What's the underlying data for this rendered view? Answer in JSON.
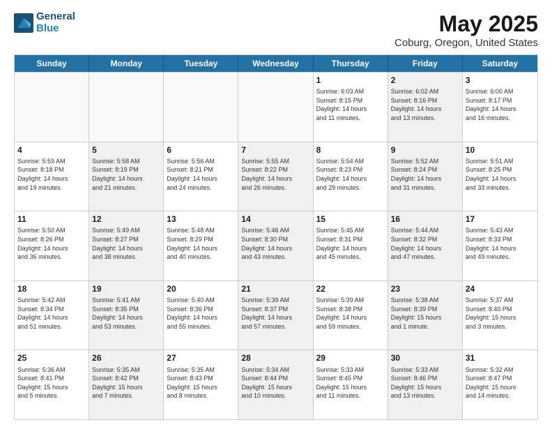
{
  "header": {
    "logo_line1": "General",
    "logo_line2": "Blue",
    "title": "May 2025",
    "subtitle": "Coburg, Oregon, United States"
  },
  "weekdays": [
    "Sunday",
    "Monday",
    "Tuesday",
    "Wednesday",
    "Thursday",
    "Friday",
    "Saturday"
  ],
  "weeks": [
    [
      {
        "day": "",
        "info": "",
        "empty": true
      },
      {
        "day": "",
        "info": "",
        "empty": true
      },
      {
        "day": "",
        "info": "",
        "empty": true
      },
      {
        "day": "",
        "info": "",
        "empty": true
      },
      {
        "day": "1",
        "info": "Sunrise: 6:03 AM\nSunset: 8:15 PM\nDaylight: 14 hours\nand 11 minutes.",
        "empty": false
      },
      {
        "day": "2",
        "info": "Sunrise: 6:02 AM\nSunset: 8:16 PM\nDaylight: 14 hours\nand 13 minutes.",
        "empty": false,
        "shaded": true
      },
      {
        "day": "3",
        "info": "Sunrise: 6:00 AM\nSunset: 8:17 PM\nDaylight: 14 hours\nand 16 minutes.",
        "empty": false
      }
    ],
    [
      {
        "day": "4",
        "info": "Sunrise: 5:59 AM\nSunset: 8:18 PM\nDaylight: 14 hours\nand 19 minutes.",
        "empty": false
      },
      {
        "day": "5",
        "info": "Sunrise: 5:58 AM\nSunset: 8:19 PM\nDaylight: 14 hours\nand 21 minutes.",
        "empty": false,
        "shaded": true
      },
      {
        "day": "6",
        "info": "Sunrise: 5:56 AM\nSunset: 8:21 PM\nDaylight: 14 hours\nand 24 minutes.",
        "empty": false
      },
      {
        "day": "7",
        "info": "Sunrise: 5:55 AM\nSunset: 8:22 PM\nDaylight: 14 hours\nand 26 minutes.",
        "empty": false,
        "shaded": true
      },
      {
        "day": "8",
        "info": "Sunrise: 5:54 AM\nSunset: 8:23 PM\nDaylight: 14 hours\nand 29 minutes.",
        "empty": false
      },
      {
        "day": "9",
        "info": "Sunrise: 5:52 AM\nSunset: 8:24 PM\nDaylight: 14 hours\nand 31 minutes.",
        "empty": false,
        "shaded": true
      },
      {
        "day": "10",
        "info": "Sunrise: 5:51 AM\nSunset: 8:25 PM\nDaylight: 14 hours\nand 33 minutes.",
        "empty": false
      }
    ],
    [
      {
        "day": "11",
        "info": "Sunrise: 5:50 AM\nSunset: 8:26 PM\nDaylight: 14 hours\nand 36 minutes.",
        "empty": false
      },
      {
        "day": "12",
        "info": "Sunrise: 5:49 AM\nSunset: 8:27 PM\nDaylight: 14 hours\nand 38 minutes.",
        "empty": false,
        "shaded": true
      },
      {
        "day": "13",
        "info": "Sunrise: 5:48 AM\nSunset: 8:29 PM\nDaylight: 14 hours\nand 40 minutes.",
        "empty": false
      },
      {
        "day": "14",
        "info": "Sunrise: 5:46 AM\nSunset: 8:30 PM\nDaylight: 14 hours\nand 43 minutes.",
        "empty": false,
        "shaded": true
      },
      {
        "day": "15",
        "info": "Sunrise: 5:45 AM\nSunset: 8:31 PM\nDaylight: 14 hours\nand 45 minutes.",
        "empty": false
      },
      {
        "day": "16",
        "info": "Sunrise: 5:44 AM\nSunset: 8:32 PM\nDaylight: 14 hours\nand 47 minutes.",
        "empty": false,
        "shaded": true
      },
      {
        "day": "17",
        "info": "Sunrise: 5:43 AM\nSunset: 8:33 PM\nDaylight: 14 hours\nand 49 minutes.",
        "empty": false
      }
    ],
    [
      {
        "day": "18",
        "info": "Sunrise: 5:42 AM\nSunset: 8:34 PM\nDaylight: 14 hours\nand 51 minutes.",
        "empty": false
      },
      {
        "day": "19",
        "info": "Sunrise: 5:41 AM\nSunset: 8:35 PM\nDaylight: 14 hours\nand 53 minutes.",
        "empty": false,
        "shaded": true
      },
      {
        "day": "20",
        "info": "Sunrise: 5:40 AM\nSunset: 8:36 PM\nDaylight: 14 hours\nand 55 minutes.",
        "empty": false
      },
      {
        "day": "21",
        "info": "Sunrise: 5:39 AM\nSunset: 8:37 PM\nDaylight: 14 hours\nand 57 minutes.",
        "empty": false,
        "shaded": true
      },
      {
        "day": "22",
        "info": "Sunrise: 5:39 AM\nSunset: 8:38 PM\nDaylight: 14 hours\nand 59 minutes.",
        "empty": false
      },
      {
        "day": "23",
        "info": "Sunrise: 5:38 AM\nSunset: 8:39 PM\nDaylight: 15 hours\nand 1 minute.",
        "empty": false,
        "shaded": true
      },
      {
        "day": "24",
        "info": "Sunrise: 5:37 AM\nSunset: 8:40 PM\nDaylight: 15 hours\nand 3 minutes.",
        "empty": false
      }
    ],
    [
      {
        "day": "25",
        "info": "Sunrise: 5:36 AM\nSunset: 8:41 PM\nDaylight: 15 hours\nand 5 minutes.",
        "empty": false
      },
      {
        "day": "26",
        "info": "Sunrise: 5:35 AM\nSunset: 8:42 PM\nDaylight: 15 hours\nand 7 minutes.",
        "empty": false,
        "shaded": true
      },
      {
        "day": "27",
        "info": "Sunrise: 5:35 AM\nSunset: 8:43 PM\nDaylight: 15 hours\nand 8 minutes.",
        "empty": false
      },
      {
        "day": "28",
        "info": "Sunrise: 5:34 AM\nSunset: 8:44 PM\nDaylight: 15 hours\nand 10 minutes.",
        "empty": false,
        "shaded": true
      },
      {
        "day": "29",
        "info": "Sunrise: 5:33 AM\nSunset: 8:45 PM\nDaylight: 15 hours\nand 11 minutes.",
        "empty": false
      },
      {
        "day": "30",
        "info": "Sunrise: 5:33 AM\nSunset: 8:46 PM\nDaylight: 15 hours\nand 13 minutes.",
        "empty": false,
        "shaded": true
      },
      {
        "day": "31",
        "info": "Sunrise: 5:32 AM\nSunset: 8:47 PM\nDaylight: 15 hours\nand 14 minutes.",
        "empty": false
      }
    ]
  ]
}
